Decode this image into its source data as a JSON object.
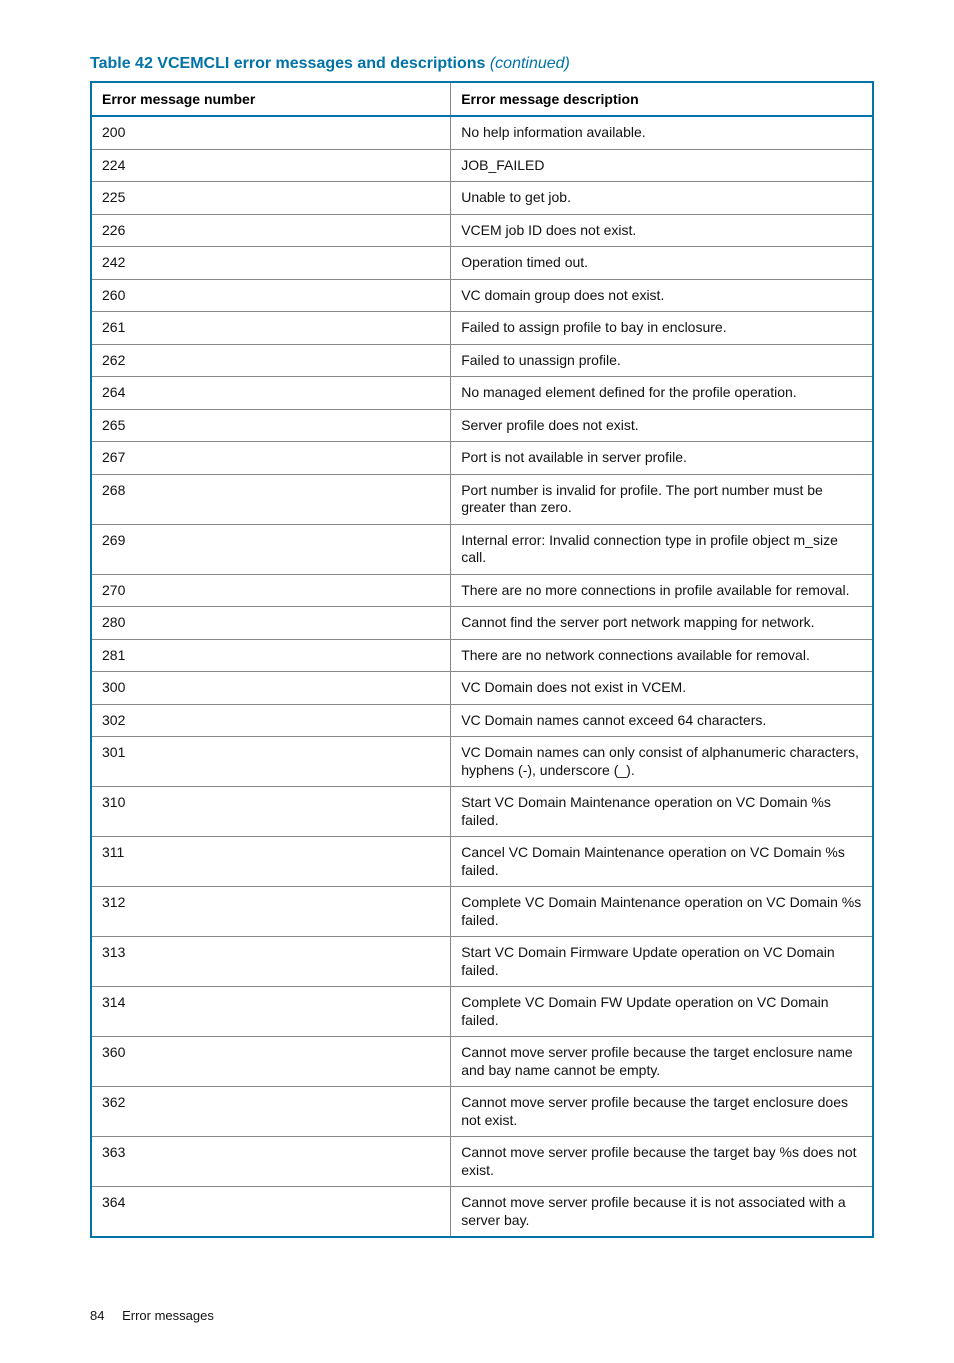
{
  "tableTitle": {
    "prefix": "Table 42 VCEMCLI error messages and descriptions",
    "suffix": " (continued)"
  },
  "headers": {
    "col1": "Error message number",
    "col2": "Error message description"
  },
  "rows": [
    {
      "num": "200",
      "desc": "No help information available."
    },
    {
      "num": "224",
      "desc": "JOB_FAILED"
    },
    {
      "num": "225",
      "desc": "Unable to get job."
    },
    {
      "num": "226",
      "desc": "VCEM job ID does not exist."
    },
    {
      "num": "242",
      "desc": "Operation timed out."
    },
    {
      "num": "260",
      "desc": "VC domain group does not exist."
    },
    {
      "num": "261",
      "desc": "Failed to assign profile to bay in enclosure."
    },
    {
      "num": "262",
      "desc": "Failed to unassign profile."
    },
    {
      "num": "264",
      "desc": "No managed element defined for the profile operation."
    },
    {
      "num": "265",
      "desc": "Server profile does not exist."
    },
    {
      "num": "267",
      "desc": "Port is not available in server profile."
    },
    {
      "num": "268",
      "desc": "Port number is invalid for profile. The port number must be greater than zero."
    },
    {
      "num": "269",
      "desc": "Internal error: Invalid connection type in profile object m_size call."
    },
    {
      "num": "270",
      "desc": "There are no more connections in profile available for removal."
    },
    {
      "num": "280",
      "desc": "Cannot find the server port network mapping for network."
    },
    {
      "num": "281",
      "desc": "There are no network connections available for removal."
    },
    {
      "num": "300",
      "desc": "VC Domain does not exist in VCEM."
    },
    {
      "num": "302",
      "desc": "VC Domain names cannot exceed 64 characters."
    },
    {
      "num": "301",
      "desc": "VC Domain names can only consist of alphanumeric characters, hyphens (-), underscore (_)."
    },
    {
      "num": "310",
      "desc": "Start VC Domain Maintenance operation on VC Domain %s failed."
    },
    {
      "num": "311",
      "desc": "Cancel VC Domain Maintenance operation on VC Domain %s failed."
    },
    {
      "num": "312",
      "desc": "Complete VC Domain Maintenance operation on VC Domain %s failed."
    },
    {
      "num": "313",
      "desc": "Start VC Domain Firmware Update operation on VC Domain failed."
    },
    {
      "num": "314",
      "desc": "Complete VC Domain FW Update operation on VC Domain failed."
    },
    {
      "num": "360",
      "desc": "Cannot move server profile because the target enclosure name and bay name cannot be empty."
    },
    {
      "num": "362",
      "desc": "Cannot move server profile because the target enclosure does not exist."
    },
    {
      "num": "363",
      "desc": "Cannot move server profile because the target bay %s does not exist."
    },
    {
      "num": "364",
      "desc": "Cannot move server profile because it is not associated with a server bay."
    }
  ],
  "footer": {
    "pageNumber": "84",
    "sectionTitle": "Error messages"
  }
}
